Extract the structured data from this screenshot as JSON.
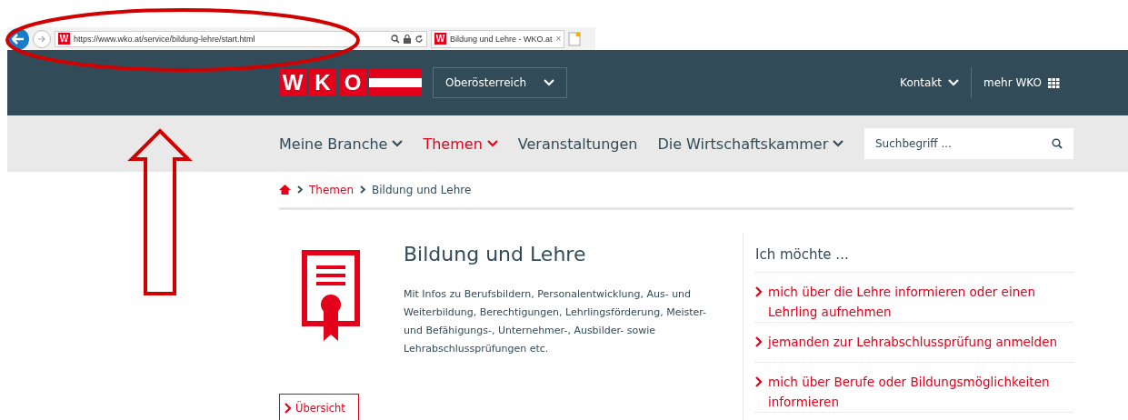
{
  "browser": {
    "url": "https://www.wko.at/service/bildung-lehre/start.html",
    "favicon_letter": "W",
    "tab_favicon_letter": "W",
    "tab_title": "Bildung und Lehre - WKO.at",
    "tab_close": "×"
  },
  "header": {
    "logo_letters": [
      "W",
      "K",
      "O"
    ],
    "region": "Oberösterreich",
    "links": [
      {
        "label": "Kontakt",
        "kind": "dropdown"
      },
      {
        "label": "mehr WKO",
        "kind": "grid"
      }
    ]
  },
  "nav": {
    "items": [
      {
        "label": "Meine Branche",
        "selected": false
      },
      {
        "label": "Themen",
        "selected": true
      },
      {
        "label": "Veranstaltungen",
        "selected": false
      },
      {
        "label": "Die Wirtschaftskammer",
        "selected": false
      }
    ],
    "search": {
      "placeholder": "Suchbegriff ..."
    }
  },
  "breadcrumb": [
    "Themen",
    "Bildung und Lehre"
  ],
  "content": {
    "title": "Bildung und Lehre",
    "description": "Mit Infos zu Berufsbildern, Personalentwicklung, Aus- und Weiterbildung, Berechtigungen, Lehrlingsförderung, Meister- und Befähigungs-, Unternehmer-, Ausbilder- sowie Lehrabschlussprüfungen etc.",
    "button": "Übersicht"
  },
  "sidebar": {
    "heading": "Ich möchte ...",
    "links": [
      "mich über die Lehre informieren oder einen Lehrling aufnehmen",
      "jemanden zur Lehrabschlussprüfung anmelden",
      "mich über Berufe oder Bildungsmöglichkeiten informieren"
    ]
  }
}
